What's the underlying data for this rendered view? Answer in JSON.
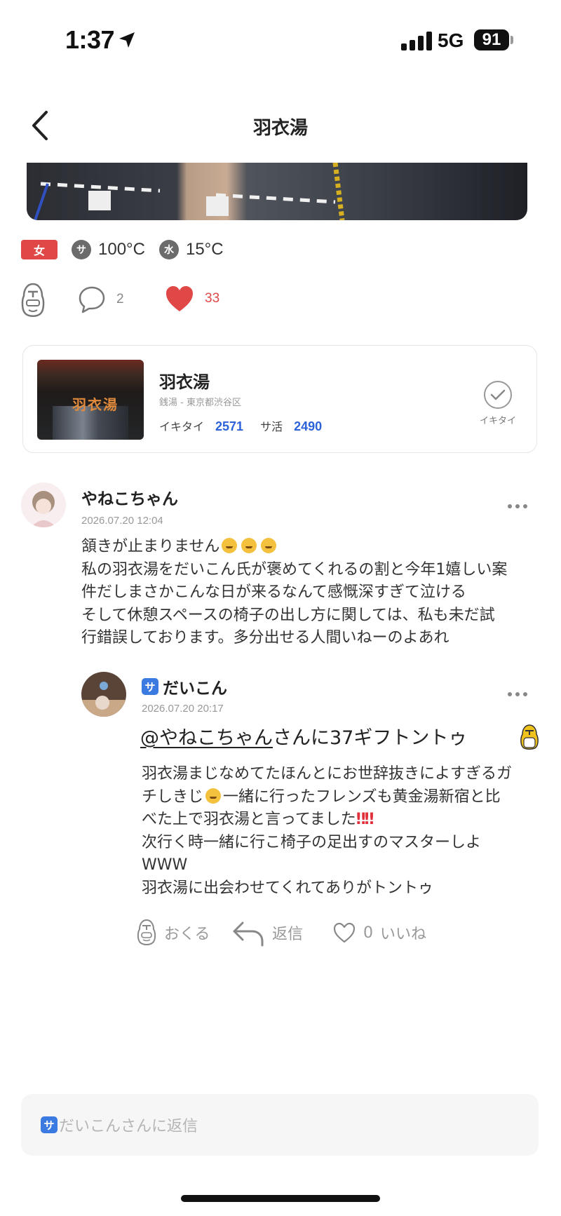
{
  "status": {
    "time": "1:37",
    "network": "5G",
    "battery": "91"
  },
  "nav": {
    "title": "羽衣湯"
  },
  "temps": {
    "gender": "女",
    "sauna_icon": "サ",
    "sauna_temp": "100°C",
    "water_icon": "水",
    "water_temp": "15°C"
  },
  "actions": {
    "comments_count": "2",
    "likes_count": "33"
  },
  "facility": {
    "name": "羽衣湯",
    "subtitle": "銭湯 - 東京都渋谷区",
    "ikitai_label": "イキタイ",
    "ikitai_count": "2571",
    "sakatsu_label": "サ活",
    "sakatsu_count": "2490",
    "button_label": "イキタイ",
    "thumb_sign": "羽衣湯"
  },
  "comment": {
    "author": "やねこちゃん",
    "time": "2026.07.20 12:04",
    "line1": "頷きが止まりません",
    "body": "私の羽衣湯をだいこん氏が褒めてくれるの割と今年1嬉しい案\n件だしまさかこんな日が来るなんて感慨深すぎて泣ける\nそして休憩スペースの椅子の出し方に関しては、私も未だ試\n行錯誤しております。多分出せる人間いねーのよあれ"
  },
  "reply": {
    "badge": "サ",
    "author": "だいこん",
    "time": "2026.07.20 20:17",
    "gift_mention": "@やねこちゃん",
    "gift_rest": "さんに37ギフトントゥ",
    "body_a": "羽衣湯まじなめてたほんとにお世辞抜きによすぎるガ\nチしきじ",
    "body_b": "一緒に行ったフレンズも黄金湯新宿と比\nべた上で羽衣湯と言ってました",
    "bangs": "‼︎‼︎",
    "body_c": "\n次行く時一緒に行こ椅子の足出すのマスターしよ\nWWW\n羽衣湯に出会わせてくれてありがトントゥ",
    "send_label": "おくる",
    "reply_label": "返信",
    "like_count": "0",
    "like_label": "いいね"
  },
  "input": {
    "badge": "サ",
    "placeholder": "だいこんさんに返信"
  },
  "colors": {
    "accent_red": "#e04848",
    "link_blue": "#2d63d8",
    "badge_blue": "#3b7ae0"
  }
}
